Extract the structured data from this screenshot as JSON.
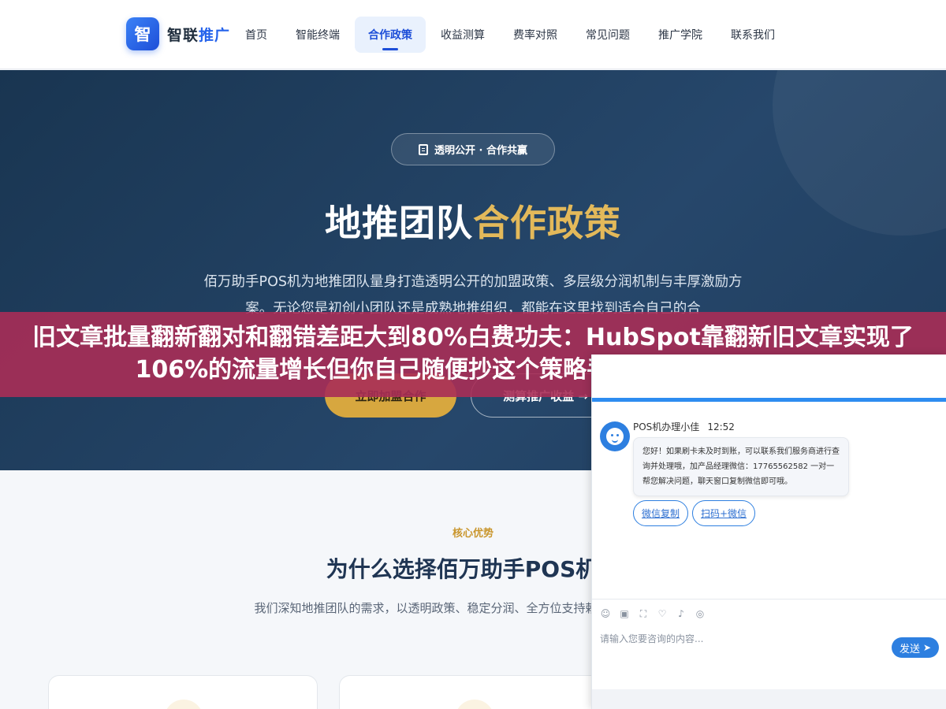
{
  "header": {
    "logo_badge": "智",
    "logo_name": "智联",
    "logo_accent": "推广",
    "nav": [
      {
        "label": "首页"
      },
      {
        "label": "智能终端"
      },
      {
        "label": "合作政策"
      },
      {
        "label": "收益测算"
      },
      {
        "label": "费率对照"
      },
      {
        "label": "常见问题"
      },
      {
        "label": "推广学院"
      },
      {
        "label": "联系我们"
      }
    ],
    "active_index": 2
  },
  "hero": {
    "pill_icon": "clipboard-icon",
    "pill": "透明公开 · 合作共赢",
    "title_white": "地推团队",
    "title_gold": "合作政策",
    "description": "佰万助手POS机为地推团队量身打造透明公开的加盟政策、多层级分润机制与丰厚激励方案。无论您是初创小团队还是成熟地推组织，都能在这里找到适合自己的合",
    "button_primary": "立即加盟合作",
    "button_secondary": "测算推广收益 →"
  },
  "banner": {
    "text": "旧文章批量翻新翻对和翻错差距大到80%白费功夫：HubSpot靠翻新旧文章实现了106%的流量增长但你自己随便抄这个策略手动翻300篇发现80"
  },
  "core": {
    "tag": "核心优势",
    "title": "为什么选择佰万助手POS机合",
    "description": "我们深知地推团队的需求，以透明政策、稳定分润、全方位支持赖的长期合作关系。"
  },
  "chat": {
    "agent_name": "POS机办理小佳",
    "time": "12:52",
    "message": "您好！如果刷卡未及时到账，可以联系我们服务商进行查询并处理哦，加产品经理微信：17765562582 一对一帮您解决问题，聊天窗口复制微信即可哦。",
    "quick_replies": [
      "微信复制",
      "扫码+微信"
    ],
    "tools": [
      "emoji-icon",
      "image-icon",
      "screenshot-icon",
      "rating-icon",
      "sound-icon",
      "wechat-icon"
    ],
    "input_placeholder": "请输入您要咨询的内容...",
    "send_label": "发送",
    "minimize": "−"
  },
  "colors": {
    "brand_blue": "#2563eb",
    "hero_bg": "#1f3c5c",
    "gold": "#d7a73f",
    "banner": "#a82e56",
    "chat_blue": "#2d7fe0"
  }
}
